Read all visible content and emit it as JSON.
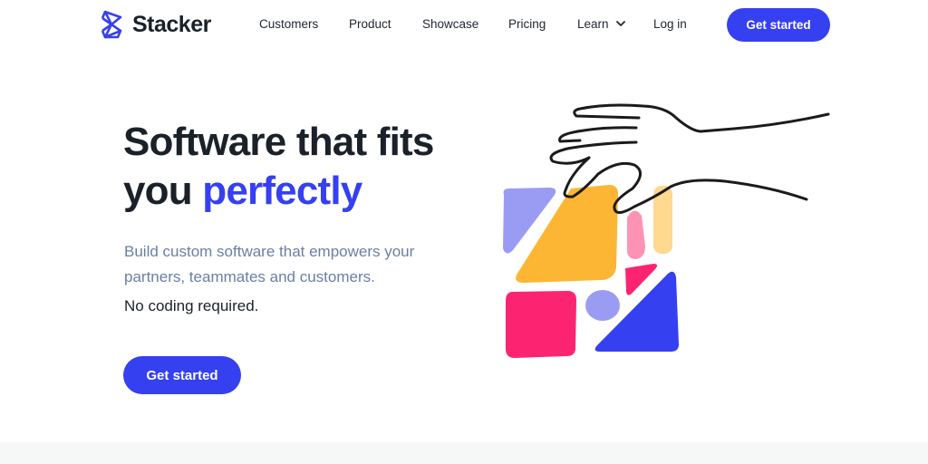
{
  "brand": {
    "name": "Stacker",
    "color": "#3540f0"
  },
  "nav": {
    "items": [
      {
        "label": "Customers"
      },
      {
        "label": "Product"
      },
      {
        "label": "Showcase"
      },
      {
        "label": "Pricing"
      },
      {
        "label": "Learn",
        "has_dropdown": true
      },
      {
        "label": "Log in"
      }
    ],
    "cta_label": "Get started"
  },
  "hero": {
    "headline_part1": "Software that fits",
    "headline_part2": "you ",
    "headline_accent": "perfectly",
    "subtitle": "Build custom software that empowers your partners, teammates and customers.",
    "note": "No coding required.",
    "cta_label": "Get started"
  },
  "illustration": {
    "description": "hand placing colorful blocks",
    "colors": {
      "lavender": "#9a9cf4",
      "orange": "#fdb634",
      "pink_light": "#fc93b5",
      "peach": "#fed98f",
      "magenta": "#fc2470",
      "blue": "#3540f0",
      "outline": "#1b1b1b"
    }
  }
}
